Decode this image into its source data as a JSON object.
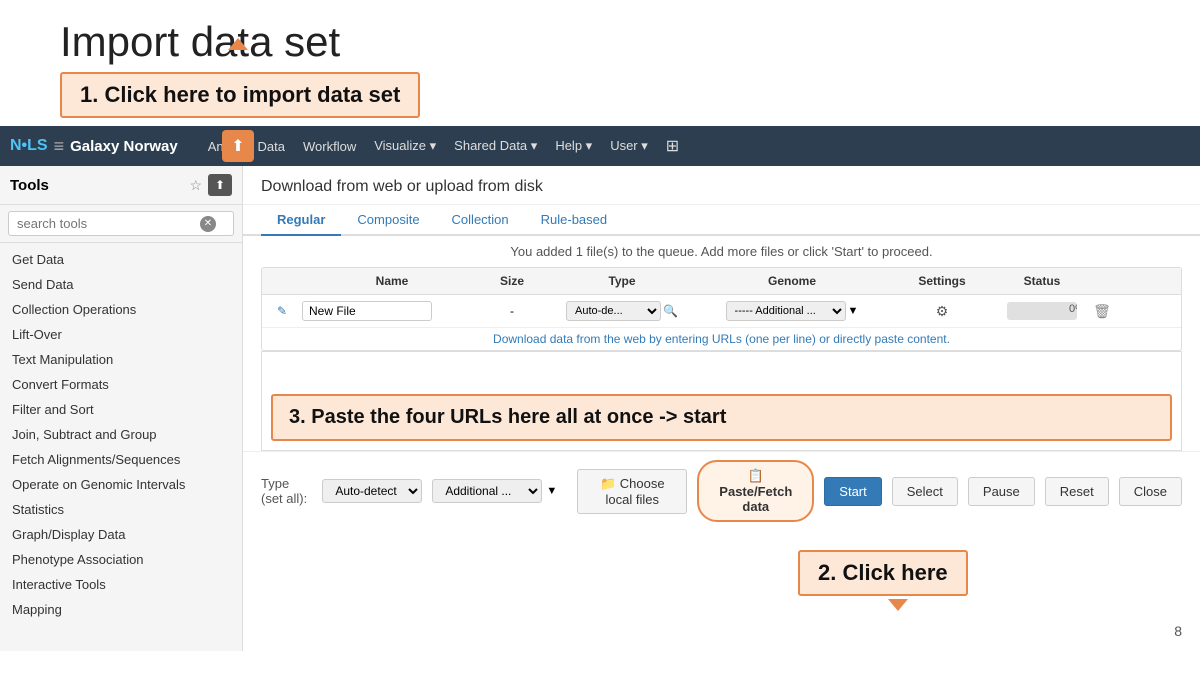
{
  "page": {
    "title": "Import data set",
    "page_number": "8"
  },
  "step1": {
    "label": "1. Click here to import data set"
  },
  "step2": {
    "label": "2. Click here"
  },
  "step3": {
    "label": "3. Paste the four URLs here all at once -> start"
  },
  "navbar": {
    "brand_nols": "N•LS",
    "separator": "≡",
    "brand_name": "Galaxy Norway",
    "links": [
      "Analyze Data",
      "Workflow",
      "Visualize ▾",
      "Shared Data ▾",
      "Help ▾",
      "User ▾"
    ],
    "grid_icon": "⊞"
  },
  "upload_panel": {
    "header": "Download from web or upload from disk",
    "tabs": [
      "Regular",
      "Composite",
      "Collection",
      "Rule-based"
    ],
    "active_tab": "Regular",
    "info_message": "You added 1 file(s) to the queue. Add more files or click 'Start' to proceed.",
    "table": {
      "headers": [
        "",
        "Name",
        "Size",
        "Type",
        "Genome",
        "Settings",
        "Status",
        ""
      ],
      "row": {
        "edit_icon": "✎",
        "name": "New File",
        "size": "-",
        "type_value": "Auto-de...",
        "genome_value": "----- Additional ...",
        "settings_icon": "⚙",
        "status_pct": "0%",
        "trash_icon": "🗑"
      },
      "url_hint": "Download data from the web by entering URLs (one per line) or directly paste content."
    },
    "bottom": {
      "type_set_label": "Type (set all):",
      "type_set_value": "Auto-detect",
      "genome_set_value": "Additional ...",
      "buttons": {
        "choose_local": "Choose local files",
        "paste_fetch": "Paste/Fetch data",
        "start": "Start",
        "select": "Select",
        "pause": "Pause",
        "reset": "Reset",
        "close": "Close"
      }
    }
  },
  "sidebar": {
    "title": "Tools",
    "search_placeholder": "search tools",
    "items": [
      "Get Data",
      "Send Data",
      "Collection Operations",
      "Lift-Over",
      "Text Manipulation",
      "Convert Formats",
      "Filter and Sort",
      "Join, Subtract and Group",
      "Fetch Alignments/Sequences",
      "Operate on Genomic Intervals",
      "Statistics",
      "Graph/Display Data",
      "Phenotype Association",
      "Interactive Tools",
      "Mapping"
    ]
  },
  "icons": {
    "star": "☆",
    "upload": "⬆",
    "edit": "✎",
    "gear": "⚙",
    "trash": "🗑",
    "search_clear": "✕",
    "local_files": "📁",
    "paste": "📋"
  }
}
